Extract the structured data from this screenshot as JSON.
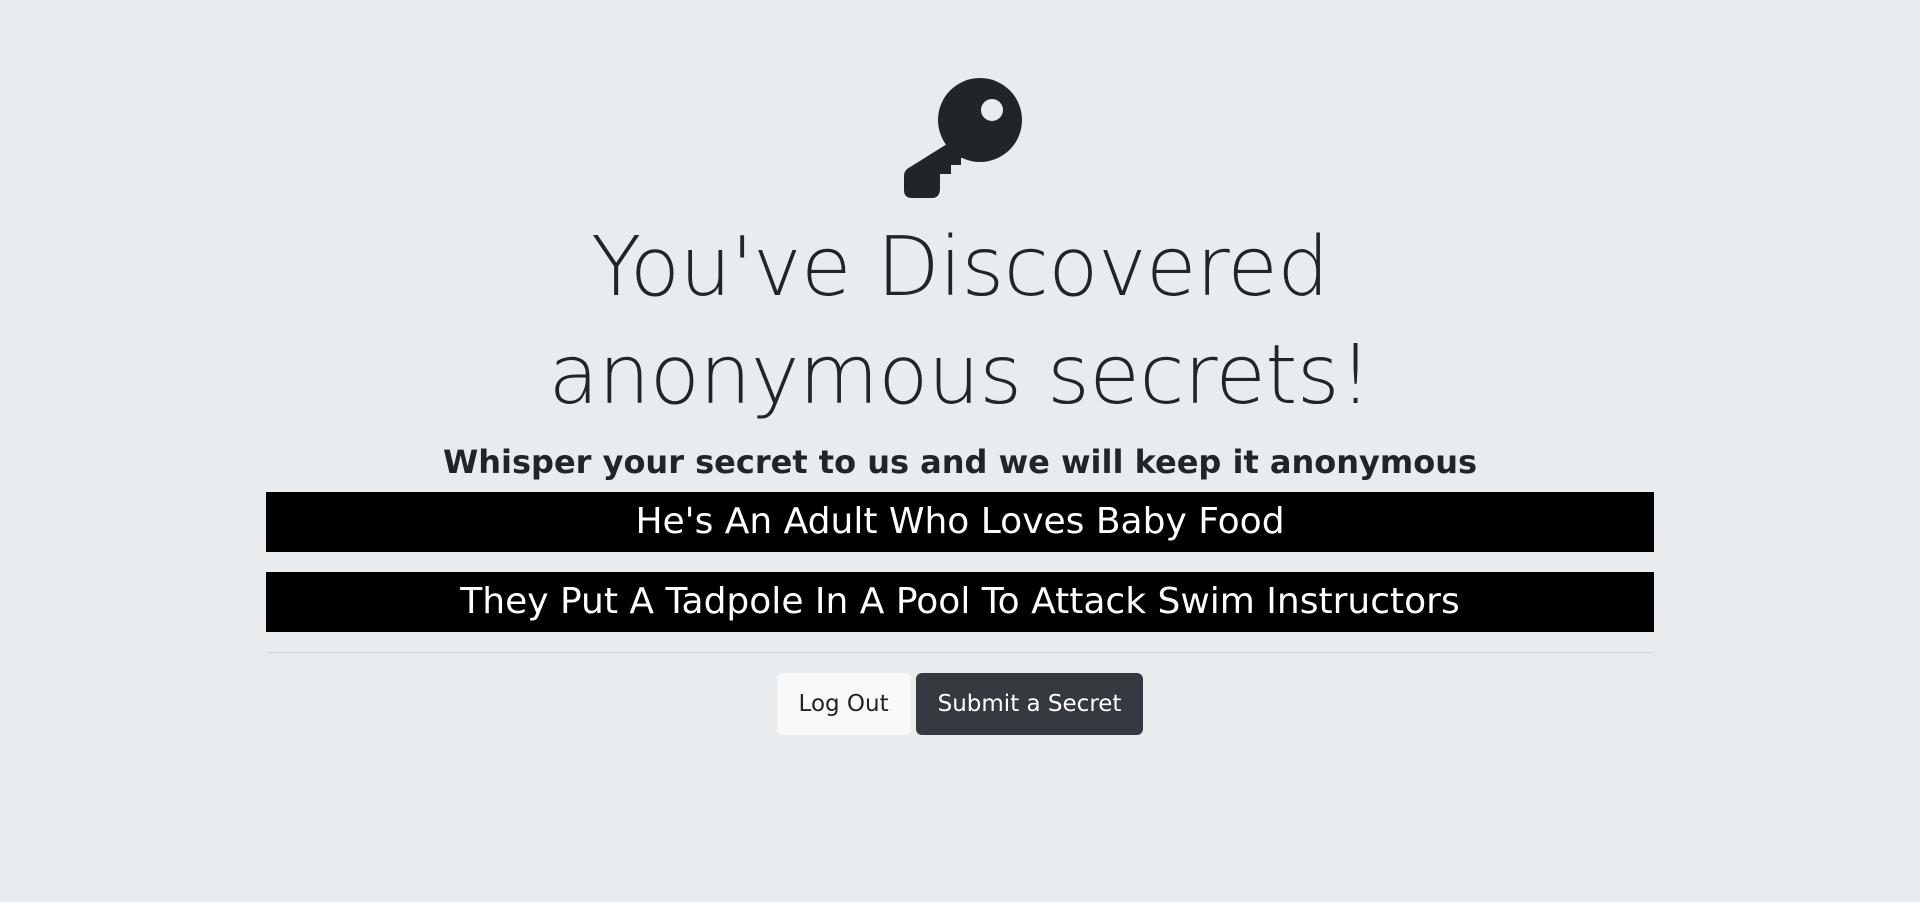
{
  "hero": {
    "icon": "key-icon",
    "title": "You've Discovered anonymous secrets!",
    "subtitle": "Whisper your secret to us and we will keep it anonymous"
  },
  "secrets": [
    "He's An Adult Who Loves Baby Food",
    "They Put A Tadpole In A Pool To Attack Swim Instructors"
  ],
  "actions": {
    "logout_label": "Log Out",
    "submit_label": "Submit a Secret"
  },
  "colors": {
    "page_background": "#e8ecef",
    "secret_background": "#000000",
    "secret_text": "#ffffff",
    "primary_button": "#343a40",
    "light_button": "#f8f9fa"
  }
}
